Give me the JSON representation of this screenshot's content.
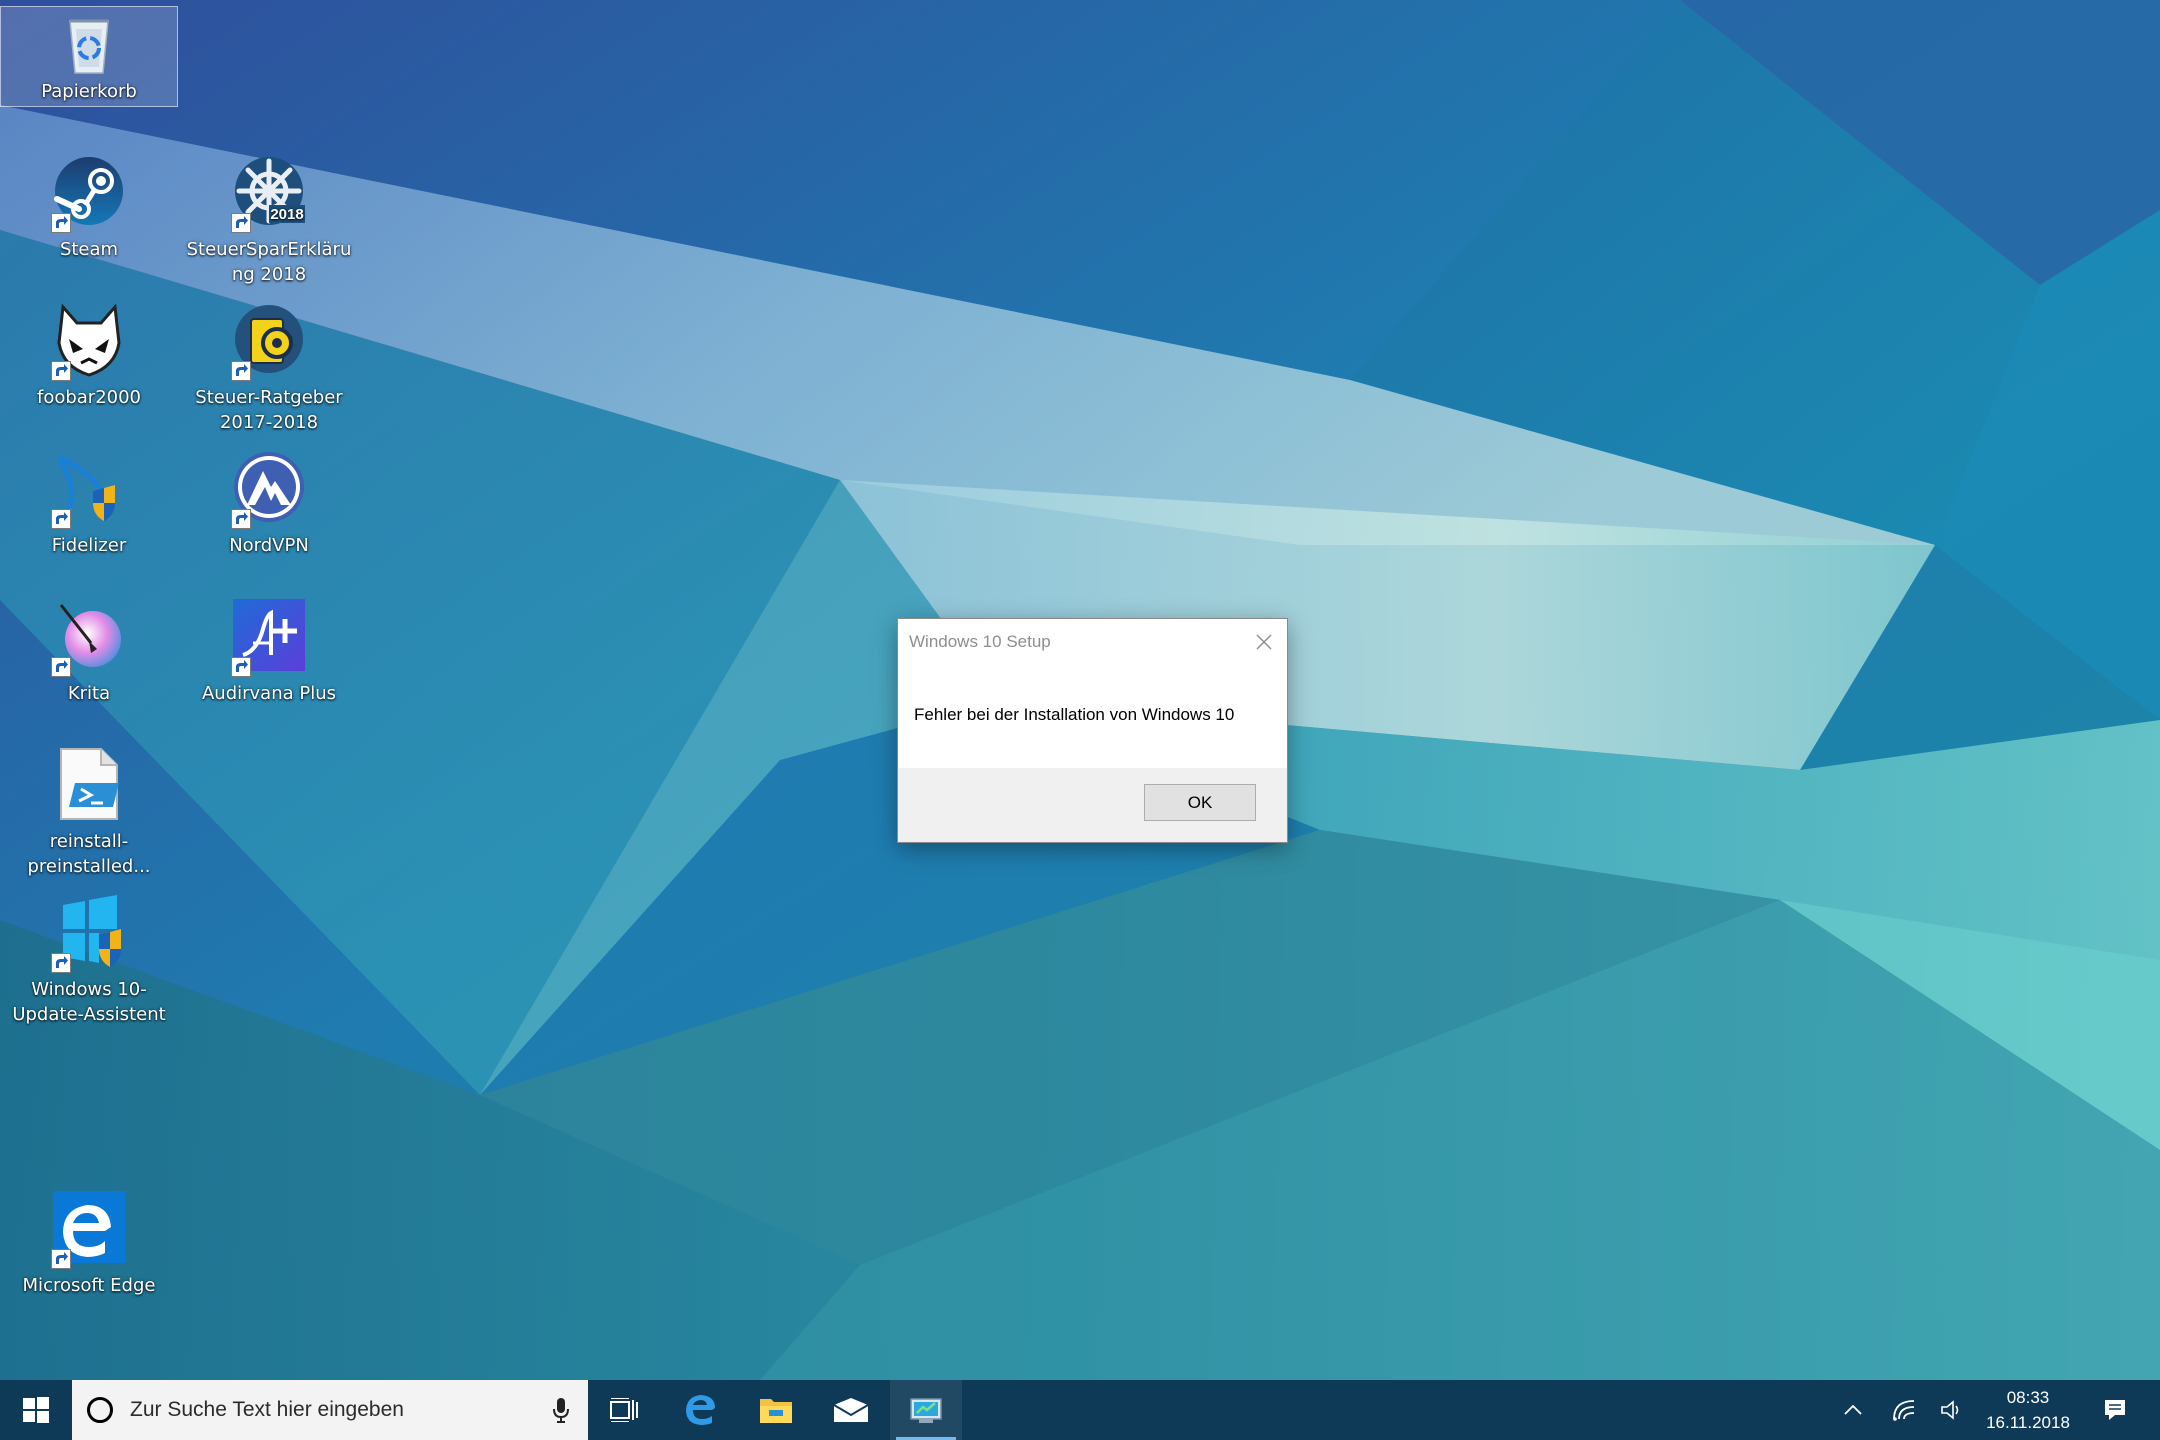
{
  "desktop": {
    "icons": [
      {
        "label": "Papierkorb",
        "icon": "recycle-bin-icon"
      },
      {
        "label": "Steam",
        "icon": "steam-icon"
      },
      {
        "label": "SteuerSparErklärung 2018",
        "icon": "steuersparerklaerung-icon",
        "badge": "2018"
      },
      {
        "label": "foobar2000",
        "icon": "foobar2000-icon"
      },
      {
        "label": "Steuer-Ratgeber 2017-2018",
        "icon": "steuer-ratgeber-icon"
      },
      {
        "label": "Fidelizer",
        "icon": "fidelizer-icon"
      },
      {
        "label": "NordVPN",
        "icon": "nordvpn-icon"
      },
      {
        "label": "Krita",
        "icon": "krita-icon"
      },
      {
        "label": "Audirvana Plus",
        "icon": "audirvana-plus-icon"
      },
      {
        "label": "reinstall-preinstalled...",
        "icon": "powershell-script-icon"
      },
      {
        "label": "Windows 10-Update-Assistent",
        "icon": "windows-update-assistant-icon"
      },
      {
        "label": "Microsoft Edge",
        "icon": "edge-icon"
      }
    ]
  },
  "dialog": {
    "title": "Windows 10 Setup",
    "message": "Fehler bei der Installation von Windows 10",
    "ok_label": "OK"
  },
  "taskbar": {
    "search_placeholder": "Zur Suche Text hier eingeben",
    "pinned": [
      "task-view-icon",
      "edge-icon",
      "file-explorer-icon",
      "mail-icon",
      "windows-setup-icon"
    ],
    "clock_time": "08:33",
    "clock_date": "16.11.2018"
  },
  "colors": {
    "taskbar": "#0f3a57",
    "accent": "#76b9ed",
    "wallpaper_top": "#2f4e98",
    "wallpaper_mid": "#1d86a9",
    "wallpaper_light": "#a8dbdc"
  }
}
